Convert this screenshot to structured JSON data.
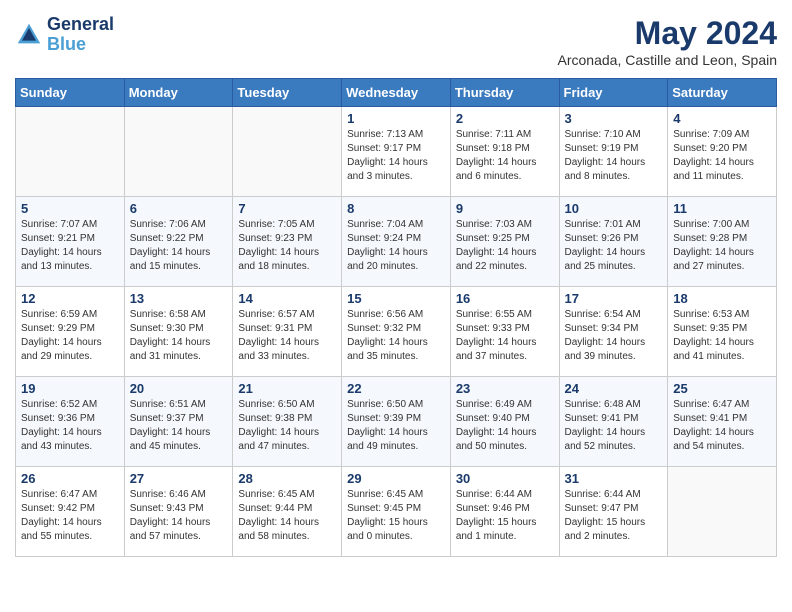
{
  "header": {
    "logo_line1": "General",
    "logo_line2": "Blue",
    "title": "May 2024",
    "subtitle": "Arconada, Castille and Leon, Spain"
  },
  "weekdays": [
    "Sunday",
    "Monday",
    "Tuesday",
    "Wednesday",
    "Thursday",
    "Friday",
    "Saturday"
  ],
  "weeks": [
    [
      {
        "day": "",
        "info": ""
      },
      {
        "day": "",
        "info": ""
      },
      {
        "day": "",
        "info": ""
      },
      {
        "day": "1",
        "info": "Sunrise: 7:13 AM\nSunset: 9:17 PM\nDaylight: 14 hours\nand 3 minutes."
      },
      {
        "day": "2",
        "info": "Sunrise: 7:11 AM\nSunset: 9:18 PM\nDaylight: 14 hours\nand 6 minutes."
      },
      {
        "day": "3",
        "info": "Sunrise: 7:10 AM\nSunset: 9:19 PM\nDaylight: 14 hours\nand 8 minutes."
      },
      {
        "day": "4",
        "info": "Sunrise: 7:09 AM\nSunset: 9:20 PM\nDaylight: 14 hours\nand 11 minutes."
      }
    ],
    [
      {
        "day": "5",
        "info": "Sunrise: 7:07 AM\nSunset: 9:21 PM\nDaylight: 14 hours\nand 13 minutes."
      },
      {
        "day": "6",
        "info": "Sunrise: 7:06 AM\nSunset: 9:22 PM\nDaylight: 14 hours\nand 15 minutes."
      },
      {
        "day": "7",
        "info": "Sunrise: 7:05 AM\nSunset: 9:23 PM\nDaylight: 14 hours\nand 18 minutes."
      },
      {
        "day": "8",
        "info": "Sunrise: 7:04 AM\nSunset: 9:24 PM\nDaylight: 14 hours\nand 20 minutes."
      },
      {
        "day": "9",
        "info": "Sunrise: 7:03 AM\nSunset: 9:25 PM\nDaylight: 14 hours\nand 22 minutes."
      },
      {
        "day": "10",
        "info": "Sunrise: 7:01 AM\nSunset: 9:26 PM\nDaylight: 14 hours\nand 25 minutes."
      },
      {
        "day": "11",
        "info": "Sunrise: 7:00 AM\nSunset: 9:28 PM\nDaylight: 14 hours\nand 27 minutes."
      }
    ],
    [
      {
        "day": "12",
        "info": "Sunrise: 6:59 AM\nSunset: 9:29 PM\nDaylight: 14 hours\nand 29 minutes."
      },
      {
        "day": "13",
        "info": "Sunrise: 6:58 AM\nSunset: 9:30 PM\nDaylight: 14 hours\nand 31 minutes."
      },
      {
        "day": "14",
        "info": "Sunrise: 6:57 AM\nSunset: 9:31 PM\nDaylight: 14 hours\nand 33 minutes."
      },
      {
        "day": "15",
        "info": "Sunrise: 6:56 AM\nSunset: 9:32 PM\nDaylight: 14 hours\nand 35 minutes."
      },
      {
        "day": "16",
        "info": "Sunrise: 6:55 AM\nSunset: 9:33 PM\nDaylight: 14 hours\nand 37 minutes."
      },
      {
        "day": "17",
        "info": "Sunrise: 6:54 AM\nSunset: 9:34 PM\nDaylight: 14 hours\nand 39 minutes."
      },
      {
        "day": "18",
        "info": "Sunrise: 6:53 AM\nSunset: 9:35 PM\nDaylight: 14 hours\nand 41 minutes."
      }
    ],
    [
      {
        "day": "19",
        "info": "Sunrise: 6:52 AM\nSunset: 9:36 PM\nDaylight: 14 hours\nand 43 minutes."
      },
      {
        "day": "20",
        "info": "Sunrise: 6:51 AM\nSunset: 9:37 PM\nDaylight: 14 hours\nand 45 minutes."
      },
      {
        "day": "21",
        "info": "Sunrise: 6:50 AM\nSunset: 9:38 PM\nDaylight: 14 hours\nand 47 minutes."
      },
      {
        "day": "22",
        "info": "Sunrise: 6:50 AM\nSunset: 9:39 PM\nDaylight: 14 hours\nand 49 minutes."
      },
      {
        "day": "23",
        "info": "Sunrise: 6:49 AM\nSunset: 9:40 PM\nDaylight: 14 hours\nand 50 minutes."
      },
      {
        "day": "24",
        "info": "Sunrise: 6:48 AM\nSunset: 9:41 PM\nDaylight: 14 hours\nand 52 minutes."
      },
      {
        "day": "25",
        "info": "Sunrise: 6:47 AM\nSunset: 9:41 PM\nDaylight: 14 hours\nand 54 minutes."
      }
    ],
    [
      {
        "day": "26",
        "info": "Sunrise: 6:47 AM\nSunset: 9:42 PM\nDaylight: 14 hours\nand 55 minutes."
      },
      {
        "day": "27",
        "info": "Sunrise: 6:46 AM\nSunset: 9:43 PM\nDaylight: 14 hours\nand 57 minutes."
      },
      {
        "day": "28",
        "info": "Sunrise: 6:45 AM\nSunset: 9:44 PM\nDaylight: 14 hours\nand 58 minutes."
      },
      {
        "day": "29",
        "info": "Sunrise: 6:45 AM\nSunset: 9:45 PM\nDaylight: 15 hours\nand 0 minutes."
      },
      {
        "day": "30",
        "info": "Sunrise: 6:44 AM\nSunset: 9:46 PM\nDaylight: 15 hours\nand 1 minute."
      },
      {
        "day": "31",
        "info": "Sunrise: 6:44 AM\nSunset: 9:47 PM\nDaylight: 15 hours\nand 2 minutes."
      },
      {
        "day": "",
        "info": ""
      }
    ]
  ]
}
